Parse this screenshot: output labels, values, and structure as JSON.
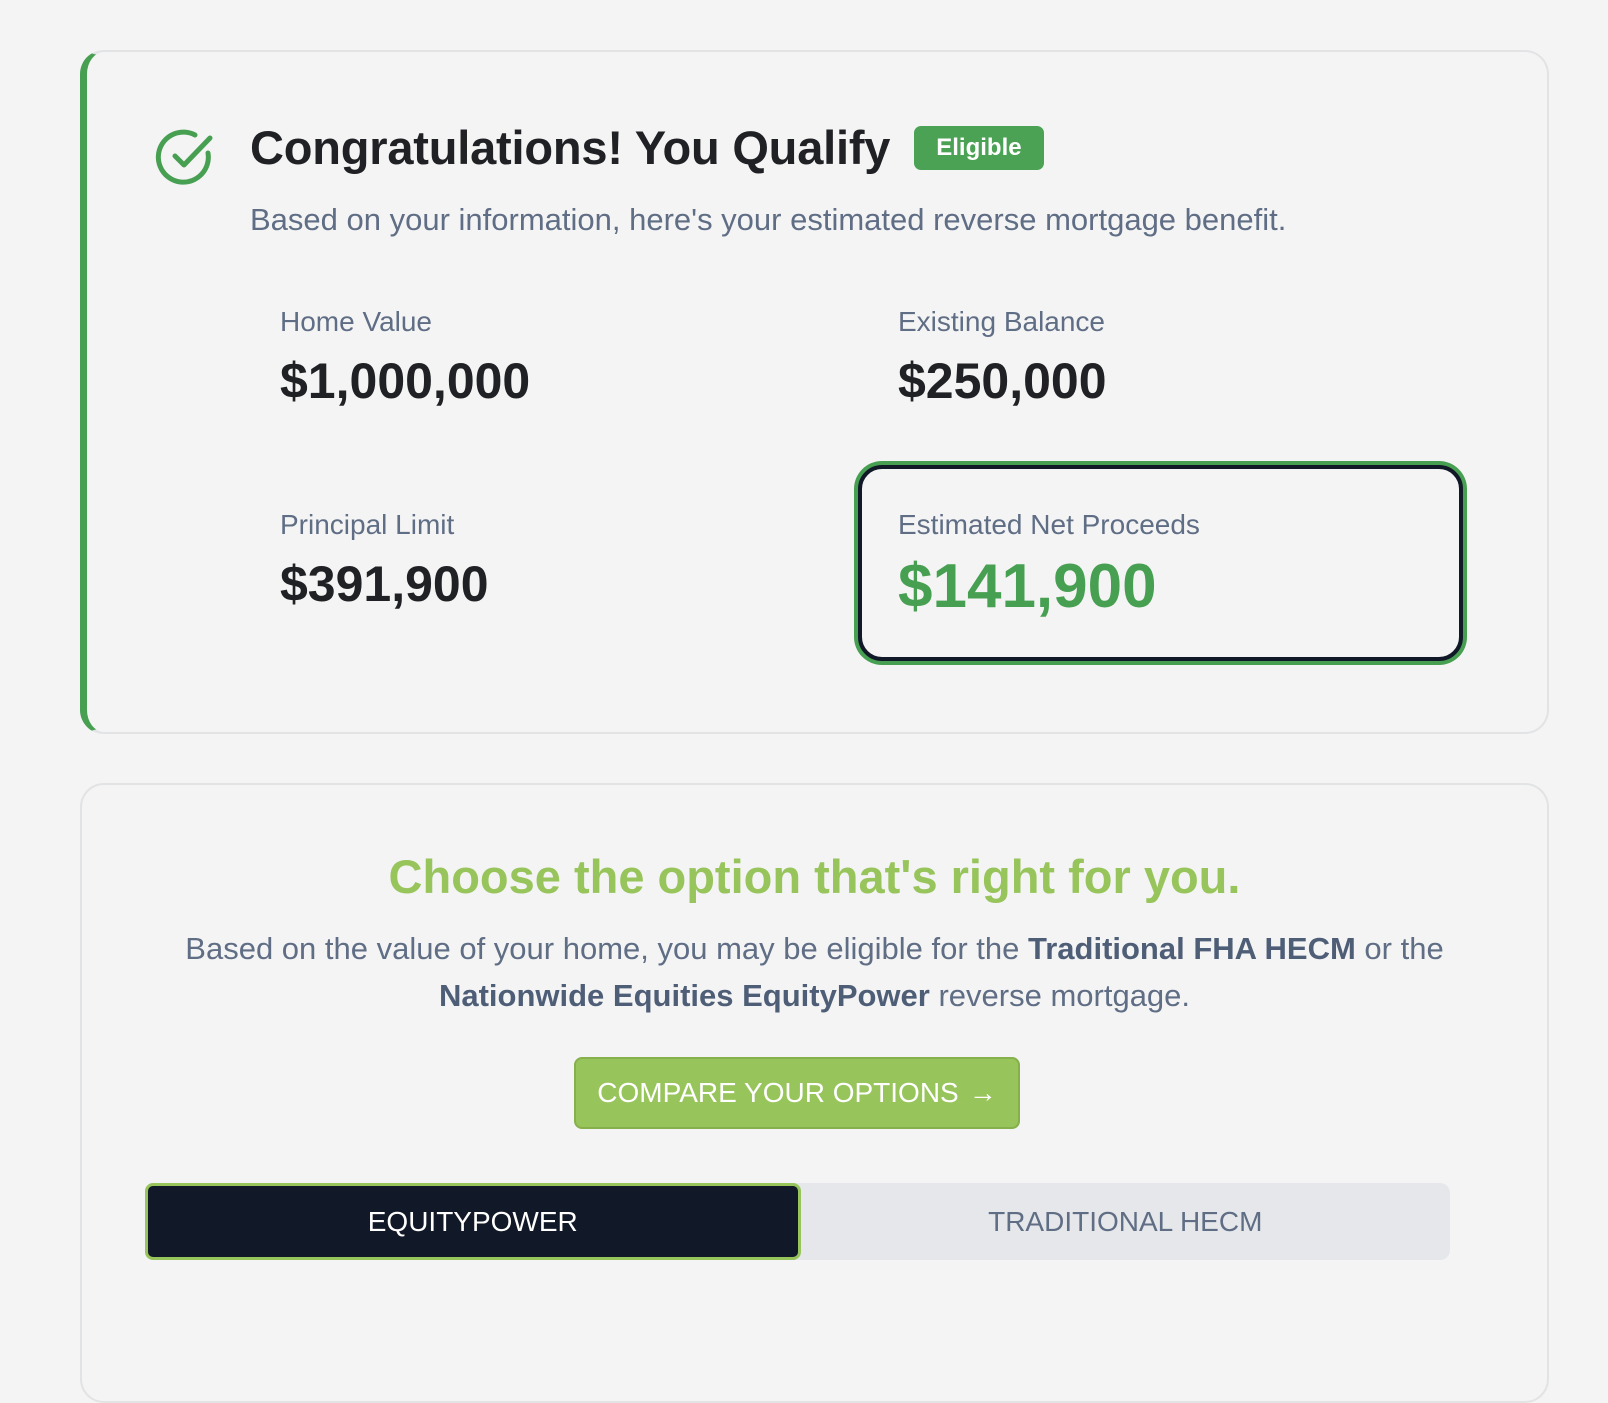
{
  "result": {
    "title": "Congratulations! You Qualify",
    "badge": "Eligible",
    "subtitle": "Based on your information, here's your estimated reverse mortgage benefit.",
    "home_value_label": "Home Value",
    "home_value": "$1,000,000",
    "existing_balance_label": "Existing Balance",
    "existing_balance": "$250,000",
    "principal_limit_label": "Principal Limit",
    "principal_limit": "$391,900",
    "net_proceeds_label": "Estimated Net Proceeds",
    "net_proceeds": "$141,900"
  },
  "options": {
    "heading": "Choose the option that's right for you.",
    "text_part1": "Based on the value of your home, you may be eligible for the ",
    "text_bold1": "Traditional FHA HECM",
    "text_part2": " or the ",
    "text_bold2": "Nationwide Equities EquityPower",
    "text_part3": " reverse mortgage.",
    "compare_label": "COMPARE YOUR OPTIONS",
    "compare_arrow": "→",
    "tabs": [
      {
        "label": "EQUITYPOWER",
        "active": true
      },
      {
        "label": "TRADITIONAL HECM",
        "active": false
      }
    ]
  },
  "colors": {
    "success_green": "#479f52",
    "brand_light_green": "#98c45c",
    "dark_navy": "#111827",
    "muted_text": "#5f6d85"
  },
  "icons": {
    "check": "check-circle-icon",
    "arrow": "arrow-right-icon"
  }
}
